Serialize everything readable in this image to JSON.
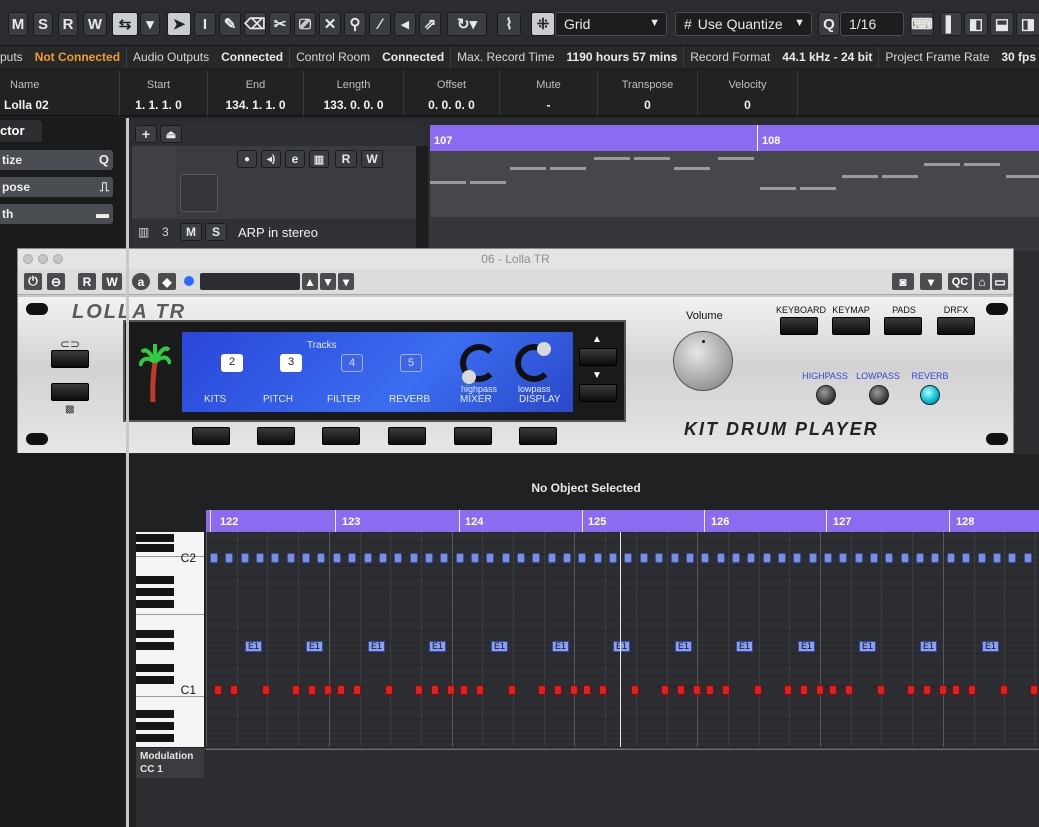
{
  "toolbar": {
    "mute_label": "M",
    "solo_label": "S",
    "read_label": "R",
    "write_label": "W",
    "grid_type": "Grid",
    "quantize_mode": "Use Quantize",
    "quantize_q": "Q",
    "quantize_value": "1/16"
  },
  "status": {
    "outputs_label": "puts",
    "outputs_value": "Not Connected",
    "audio_outputs_label": "Audio Outputs",
    "audio_outputs_value": "Connected",
    "control_room_label": "Control Room",
    "control_room_value": "Connected",
    "max_record_label": "Max. Record Time",
    "max_record_value": "1190 hours 57 mins",
    "record_format_label": "Record Format",
    "record_format_value": "44.1 kHz - 24 bit",
    "frame_rate_label": "Project Frame Rate",
    "frame_rate_value": "30 fps"
  },
  "infoline": {
    "name_h": "Name",
    "name_v": "Lolla 02",
    "start_h": "Start",
    "start_v": "1. 1. 1. 0",
    "end_h": "End",
    "end_v": "134. 1. 1. 0",
    "length_h": "Length",
    "length_v": "133. 0. 0. 0",
    "offset_h": "Offset",
    "offset_v": "0. 0. 0. 0",
    "mute_h": "Mute",
    "mute_v": "-",
    "transpose_h": "Transpose",
    "transpose_v": "0",
    "velocity_h": "Velocity",
    "velocity_v": "0"
  },
  "inspector": {
    "tab": "ctor",
    "rows": [
      {
        "label": "tize",
        "icon": "Q"
      },
      {
        "label": "pose",
        "icon": "⎍"
      },
      {
        "label": "th",
        "icon": "▬"
      }
    ]
  },
  "project": {
    "ruler_107": "107",
    "ruler_108": "108",
    "track_num": "3",
    "track_m": "M",
    "track_s": "S",
    "track_name": "ARP in stereo",
    "track_r": "R",
    "track_w": "W"
  },
  "plugin": {
    "window_title": "06 - Lolla TR",
    "bar_r": "R",
    "bar_w": "W",
    "bar_a": "a",
    "bar_qc": "QC",
    "logo": "LOLLA TR",
    "tracks_label": "Tracks",
    "track_nums": [
      "2",
      "3",
      "4",
      "5"
    ],
    "lcd_labels": [
      "KITS",
      "PITCH",
      "FILTER",
      "REVERB",
      "MIXER",
      "DISPLAY"
    ],
    "knob1": "highpass",
    "knob2": "lowpass",
    "volume": "Volume",
    "pad_labels": [
      "KEYBOARD",
      "KEYMAP",
      "PADS",
      "DRFX"
    ],
    "filter_labels": [
      "HIGHPASS",
      "LOWPASS",
      "REVERB"
    ],
    "subtitle": "KIT DRUM PLAYER",
    "reverb_on": true
  },
  "key_editor": {
    "no_object": "No Object Selected",
    "bars": [
      "122",
      "123",
      "124",
      "125",
      "126",
      "127",
      "128"
    ],
    "key_c2": "C2",
    "key_c1": "C1",
    "e1_note": "E1",
    "mod_label": "Modulation",
    "mod_cc": "CC 1"
  }
}
